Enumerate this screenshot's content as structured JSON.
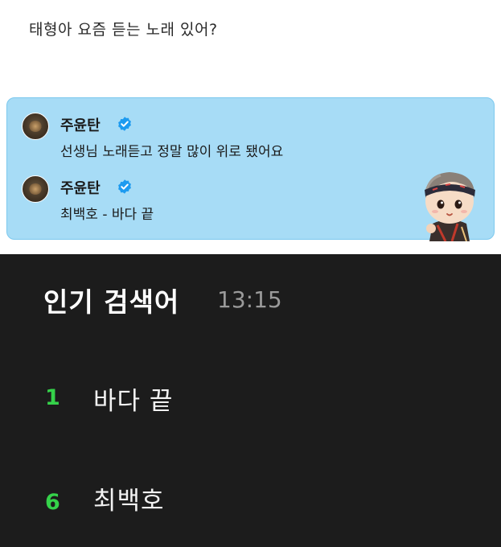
{
  "question": "태형아 요즘 듣는 노래 있어?",
  "replies": [
    {
      "name": "주윤탄",
      "verified": true,
      "text": "선생님 노래듣고 정말 많이 위로 됐어요"
    },
    {
      "name": "주윤탄",
      "verified": true,
      "text": "최백호 - 바다 끝"
    }
  ],
  "trending": {
    "title": "인기 검색어",
    "time": "13:15",
    "items": [
      {
        "rank": "1",
        "term": "바다 끝"
      },
      {
        "rank": "6",
        "term": "최백호"
      }
    ]
  },
  "colors": {
    "card_bg": "#a7dcf6",
    "card_border": "#7cc8ee",
    "verified_badge": "#1d9bf0",
    "dark_bg": "#1c1c1c",
    "rank_green": "#35d24a"
  },
  "icons": [
    "verified-badge-icon",
    "avatar",
    "sticker-character"
  ]
}
